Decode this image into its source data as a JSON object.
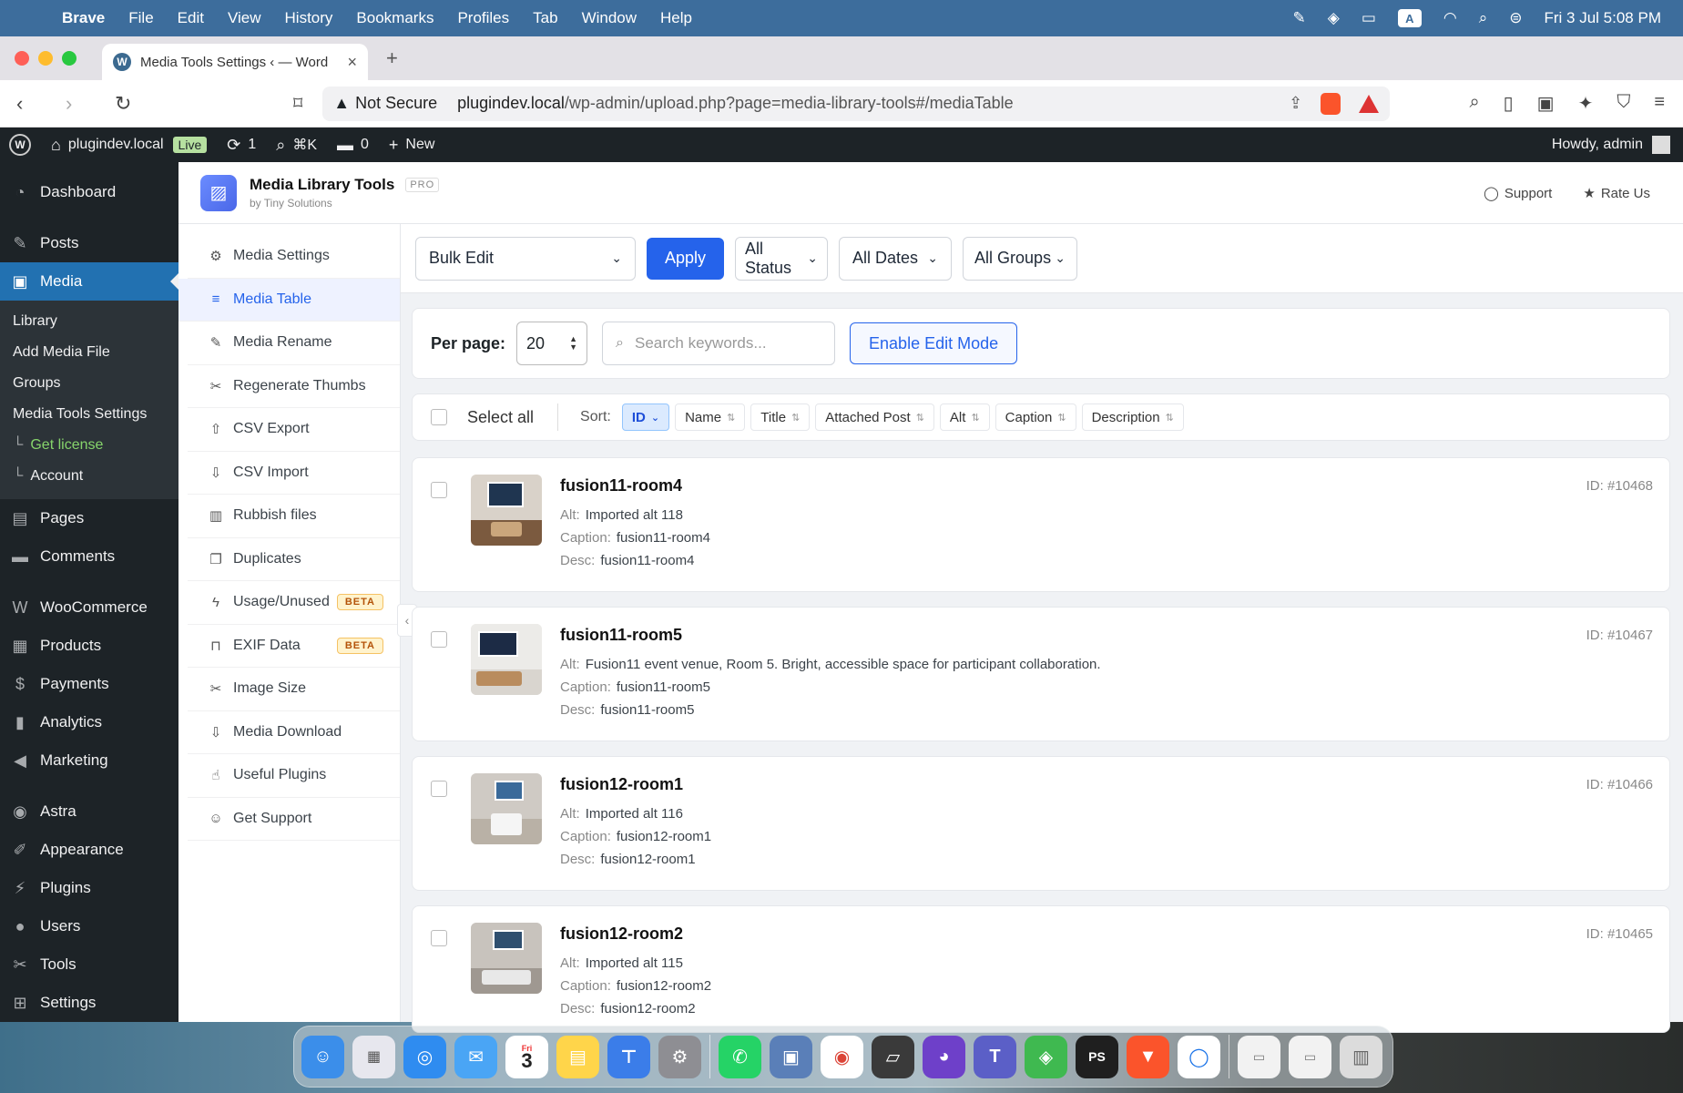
{
  "menubar": {
    "app": "Brave",
    "items": [
      "File",
      "Edit",
      "View",
      "History",
      "Bookmarks",
      "Profiles",
      "Tab",
      "Window",
      "Help"
    ],
    "input_badge": "A",
    "clock": "Fri 3 Jul  5:08 PM"
  },
  "browser": {
    "tab_title": "Media Tools Settings ‹ — Word",
    "security": "Not Secure",
    "url_host": "plugindev.local",
    "url_path": "/wp-admin/upload.php?page=media-library-tools#/mediaTable"
  },
  "adminbar": {
    "site": "plugindev.local",
    "live": "Live",
    "updates": "1",
    "search_shortcut": "⌘K",
    "comments": "0",
    "new": "New",
    "howdy": "Howdy, admin"
  },
  "wp_menu": {
    "dashboard": "Dashboard",
    "posts": "Posts",
    "media": "Media",
    "media_sub": [
      "Library",
      "Add Media File",
      "Groups",
      "Media Tools Settings"
    ],
    "get_license": "Get license",
    "account": "Account",
    "pages": "Pages",
    "comments": "Comments",
    "woocommerce": "WooCommerce",
    "products": "Products",
    "payments": "Payments",
    "analytics": "Analytics",
    "marketing": "Marketing",
    "astra": "Astra",
    "appearance": "Appearance",
    "plugins": "Plugins",
    "users": "Users",
    "tools": "Tools",
    "settings": "Settings"
  },
  "plugin": {
    "name": "Media Library Tools",
    "badge": "PRO",
    "by": "by Tiny Solutions",
    "support": "Support",
    "rate": "Rate Us"
  },
  "plugin_nav": {
    "media_settings": "Media Settings",
    "media_table": "Media Table",
    "media_rename": "Media Rename",
    "regenerate": "Regenerate Thumbs",
    "csv_export": "CSV Export",
    "csv_import": "CSV Import",
    "rubbish": "Rubbish files",
    "duplicates": "Duplicates",
    "usage": "Usage/Unused",
    "exif": "EXIF Data",
    "beta": "BETA",
    "image_size": "Image Size",
    "download": "Media Download",
    "useful": "Useful Plugins",
    "get_support": "Get Support"
  },
  "filters": {
    "bulk": "Bulk Edit",
    "apply": "Apply",
    "status": "All Status",
    "dates": "All Dates",
    "groups": "All Groups"
  },
  "controls": {
    "per_page_label": "Per page:",
    "per_page": "20",
    "search_placeholder": "Search keywords...",
    "edit_mode": "Enable Edit Mode"
  },
  "sort": {
    "select_all": "Select all",
    "label": "Sort:",
    "cols": [
      "ID",
      "Name",
      "Title",
      "Attached Post",
      "Alt",
      "Caption",
      "Description"
    ]
  },
  "labels": {
    "alt": "Alt:",
    "caption": "Caption:",
    "desc": "Desc:"
  },
  "rows": [
    {
      "title": "fusion11-room4",
      "alt": "Imported alt 118",
      "caption": "fusion11-room4",
      "desc": "fusion11-room4",
      "id": "ID: #10468"
    },
    {
      "title": "fusion11-room5",
      "alt": "Fusion11 event venue, Room 5. Bright, accessible space for participant collaboration.",
      "caption": "fusion11-room5",
      "desc": "fusion11-room5",
      "id": "ID: #10467"
    },
    {
      "title": "fusion12-room1",
      "alt": "Imported alt 116",
      "caption": "fusion12-room1",
      "desc": "fusion12-room1",
      "id": "ID: #10466"
    },
    {
      "title": "fusion12-room2",
      "alt": "Imported alt 115",
      "caption": "fusion12-room2",
      "desc": "fusion12-room2",
      "id": "ID: #10465"
    }
  ],
  "dock": {
    "calendar_day": "Fri",
    "calendar_date": "3"
  }
}
